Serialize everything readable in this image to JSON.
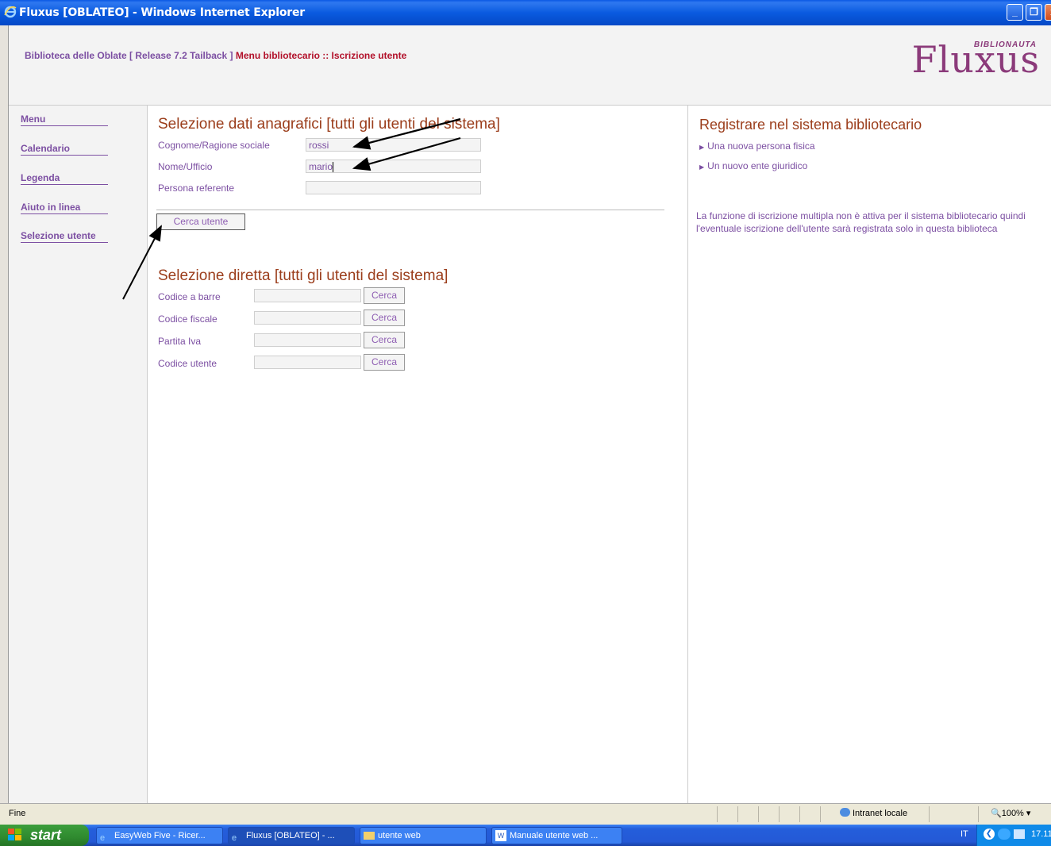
{
  "window": {
    "title": "Fluxus [OBLATEO] - Windows Internet Explorer",
    "minimize_label": "_",
    "maximize_label": "❐",
    "close_label": "x"
  },
  "header": {
    "crumb_library": "Biblioteca delle Oblate [ Release 7.2 Tailback ]",
    "crumb_path": "Menu bibliotecario :: Iscrizione utente",
    "logo_word": "Fluxus",
    "logo_sub": "BIBLIONAUTA"
  },
  "nav": {
    "items": [
      {
        "label": "Menu"
      },
      {
        "label": "Calendario"
      },
      {
        "label": "Legenda"
      },
      {
        "label": "Aiuto in linea"
      },
      {
        "label": "Selezione utente"
      }
    ]
  },
  "anagrafica": {
    "title": "Selezione dati anagrafici [tutti gli utenti del sistema]",
    "cognome_label": "Cognome/Ragione sociale",
    "cognome_value": "rossi",
    "nome_label": "Nome/Ufficio",
    "nome_value": "mario",
    "referente_label": "Persona referente",
    "referente_value": "",
    "search_button": "Cerca utente"
  },
  "diretta": {
    "title": "Selezione diretta [tutti gli utenti del sistema]",
    "rows": [
      {
        "label": "Codice a barre",
        "value": "",
        "button": "Cerca"
      },
      {
        "label": "Codice fiscale",
        "value": "",
        "button": "Cerca"
      },
      {
        "label": "Partita Iva",
        "value": "",
        "button": "Cerca"
      },
      {
        "label": "Codice utente",
        "value": "",
        "button": "Cerca"
      }
    ]
  },
  "right": {
    "title": "Registrare nel sistema bibliotecario",
    "links": [
      {
        "label": "Una nuova persona fisica"
      },
      {
        "label": "Un nuovo ente giuridico"
      }
    ],
    "note": "La funzione di iscrizione multipla non è attiva per il sistema bibliotecario quindi l'eventuale iscrizione dell'utente sarà registrata solo in questa biblioteca"
  },
  "statusbar": {
    "text": "Fine",
    "zone": "Intranet locale",
    "zoom": "100%",
    "zoom_arrow": "▾"
  },
  "taskbar": {
    "start_label": "start",
    "tasks": [
      {
        "label": "EasyWeb Five - Ricer...",
        "icon": "ie-icon"
      },
      {
        "label": "Fluxus [OBLATEO] - ...",
        "icon": "ie-icon"
      },
      {
        "label": "utente web",
        "icon": "folder-icon"
      },
      {
        "label": "Manuale utente web ...",
        "icon": "word-icon"
      }
    ],
    "lang": "IT",
    "clock": "17.11"
  },
  "colors": {
    "link_purple": "#7c4fa2",
    "heading_brown": "#9b3d1b",
    "crumb_red": "#b2102a",
    "logo_purple": "#8b3a7a"
  }
}
